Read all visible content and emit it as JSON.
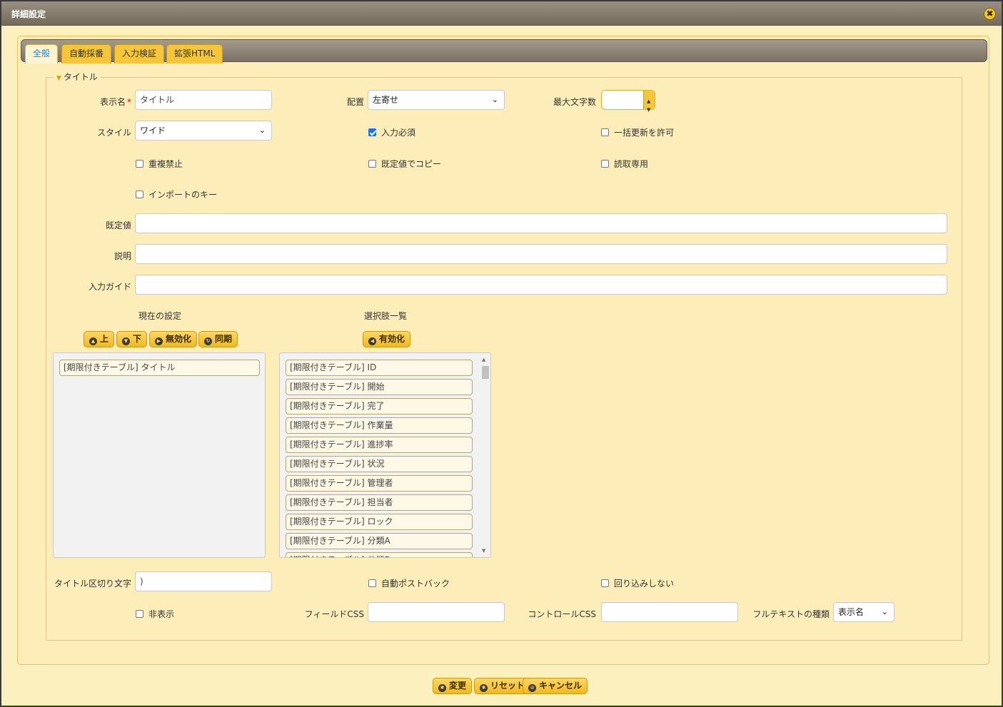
{
  "dialog": {
    "title": "詳細設定",
    "close_glyph": "✖"
  },
  "tabs": [
    "全般",
    "自動採番",
    "入力検証",
    "拡張HTML"
  ],
  "legend": "タイトル",
  "fields": {
    "display_name_label": "表示名",
    "display_name_required": "*",
    "display_name_value": "タイトル",
    "align_label": "配置",
    "align_value": "左寄せ",
    "max_chars_label": "最大文字数",
    "style_label": "スタイル",
    "style_value": "ワイド",
    "default_label": "既定値",
    "description_label": "説明",
    "input_guide_label": "入力ガイド",
    "title_sep_label": "タイトル区切り文字",
    "title_sep_value": ")",
    "field_css_label": "フィールドCSS",
    "control_css_label": "コントロールCSS",
    "fulltext_label": "フルテキストの種類",
    "fulltext_value": "表示名"
  },
  "checkboxes": {
    "required": {
      "label": "入力必須",
      "checked": true
    },
    "bulk_update": {
      "label": "一括更新を許可",
      "checked": false
    },
    "no_duplicate": {
      "label": "重複禁止",
      "checked": false
    },
    "copy_default": {
      "label": "既定値でコピー",
      "checked": false
    },
    "read_only": {
      "label": "読取専用",
      "checked": false
    },
    "import_key": {
      "label": "インポートのキー",
      "checked": false
    },
    "auto_postback": {
      "label": "自動ポストバック",
      "checked": false
    },
    "no_wrap": {
      "label": "回り込みしない",
      "checked": false
    },
    "hidden": {
      "label": "非表示",
      "checked": false
    }
  },
  "current": {
    "header": "現在の設定",
    "buttons": {
      "up": "上",
      "down": "下",
      "disable": "無効化",
      "sync": "同期"
    },
    "items": [
      "[期限付きテーブル] タイトル"
    ]
  },
  "choices": {
    "header": "選択肢一覧",
    "buttons": {
      "enable": "有効化"
    },
    "items": [
      "[期限付きテーブル] ID",
      "[期限付きテーブル] 開始",
      "[期限付きテーブル] 完了",
      "[期限付きテーブル] 作業量",
      "[期限付きテーブル] 進捗率",
      "[期限付きテーブル] 状況",
      "[期限付きテーブル] 管理者",
      "[期限付きテーブル] 担当者",
      "[期限付きテーブル] ロック",
      "[期限付きテーブル] 分類A",
      "[期限付きテーブル] 分類B"
    ]
  },
  "footer": {
    "change": "変更",
    "reset": "リセット",
    "cancel": "キャンセル"
  }
}
